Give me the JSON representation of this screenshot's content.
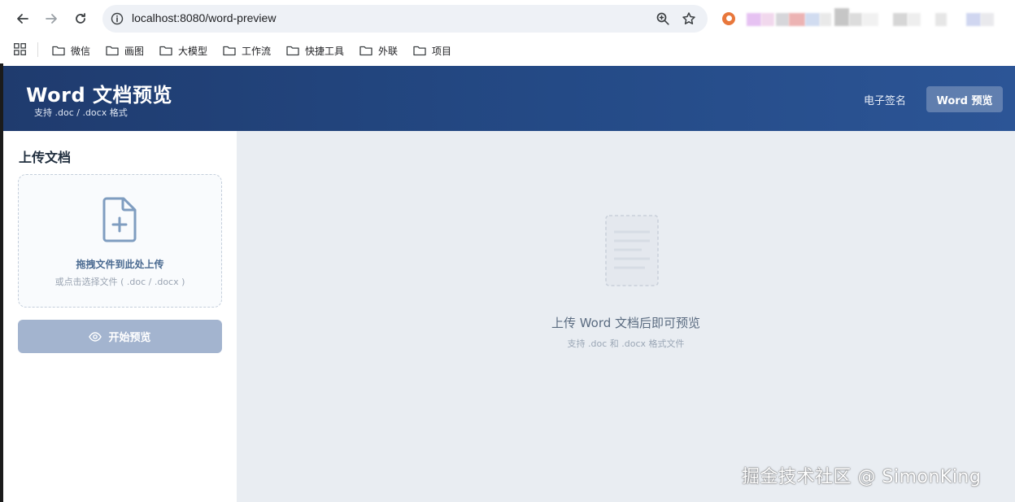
{
  "browser": {
    "url": "localhost:8080/word-preview",
    "bookmarks": [
      {
        "label": "微信"
      },
      {
        "label": "画图"
      },
      {
        "label": "大模型"
      },
      {
        "label": "工作流"
      },
      {
        "label": "快捷工具"
      },
      {
        "label": "外联"
      },
      {
        "label": "项目"
      }
    ]
  },
  "header": {
    "title": "Word 文档预览",
    "subtitle": "支持 .doc / .docx 格式",
    "nav": {
      "esign": "电子签名",
      "word_preview": "Word 预览"
    },
    "gradient_start": "#1f3b6e",
    "gradient_end": "#2c5596"
  },
  "sidebar": {
    "title": "上传文档",
    "dropzone": {
      "main_text": "拖拽文件到此处上传",
      "sub_text": "或点击选择文件 ( .doc / .docx )"
    },
    "start_button": "开始预览"
  },
  "preview": {
    "empty_title": "上传 Word 文档后即可预览",
    "empty_sub": "支持 .doc 和 .docx 格式文件"
  },
  "watermark": "掘金技术社区 @ SimonKing",
  "colors": {
    "accent": "#244a86",
    "button_disabled": "#a3b4cf",
    "preview_bg": "#e9edf2"
  }
}
